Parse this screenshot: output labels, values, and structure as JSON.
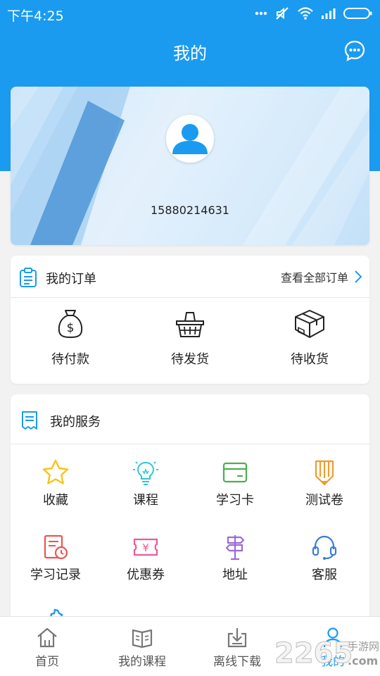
{
  "status_bar": {
    "time": "下午4:25"
  },
  "header": {
    "title": "我的"
  },
  "profile": {
    "phone": "15880214631"
  },
  "orders": {
    "title": "我的订单",
    "view_all": "查看全部订单",
    "items": [
      {
        "label": "待付款",
        "icon": "money-bag-icon"
      },
      {
        "label": "待发货",
        "icon": "basket-icon"
      },
      {
        "label": "待收货",
        "icon": "package-icon"
      }
    ]
  },
  "services": {
    "title": "我的服务",
    "items": [
      {
        "label": "收藏",
        "icon": "star-icon"
      },
      {
        "label": "课程",
        "icon": "lightbulb-icon"
      },
      {
        "label": "学习卡",
        "icon": "card-icon"
      },
      {
        "label": "测试卷",
        "icon": "pencil-icon"
      },
      {
        "label": "学习记录",
        "icon": "record-icon"
      },
      {
        "label": "优惠券",
        "icon": "coupon-icon"
      },
      {
        "label": "地址",
        "icon": "signpost-icon"
      },
      {
        "label": "客服",
        "icon": "headset-icon"
      }
    ]
  },
  "tabbar": {
    "items": [
      {
        "label": "首页",
        "icon": "home-icon"
      },
      {
        "label": "我的课程",
        "icon": "book-icon"
      },
      {
        "label": "离线下载",
        "icon": "download-icon"
      },
      {
        "label": "我的",
        "icon": "person-icon"
      }
    ],
    "active_index": 3
  },
  "watermark": {
    "number": "2265",
    "text_top": "手游网",
    "text_bottom": ".com"
  },
  "colors": {
    "primary": "#1a9bf0",
    "star": "#f5c518",
    "bulb": "#2ec7d8",
    "card": "#4caf50",
    "pencil": "#f39a2b",
    "record": "#ef5350",
    "coupon": "#e95a9b",
    "signpost": "#9c6ad6",
    "headset": "#3a7bd5"
  }
}
